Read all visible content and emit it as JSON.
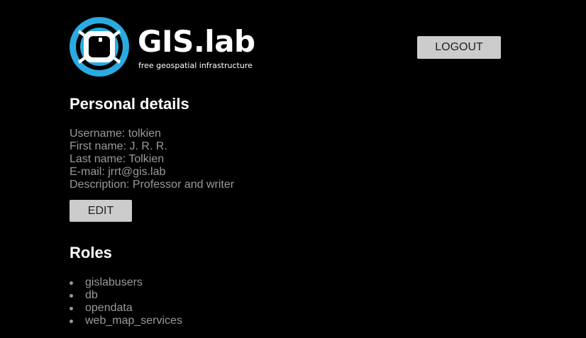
{
  "header": {
    "logo": {
      "title": "GIS.lab",
      "tagline": "free geospatial infrastructure",
      "icon": "gislab-logo-icon",
      "accent_color": "#29abe2"
    },
    "logout_label": "LOGOUT"
  },
  "personal_details": {
    "title": "Personal details",
    "rows": [
      "Username: tolkien",
      "First name: J. R. R.",
      "Last name: Tolkien",
      "E-mail: jrrt@gis.lab",
      "Description: Professor and writer"
    ],
    "edit_label": "EDIT"
  },
  "roles": {
    "title": "Roles",
    "items": [
      "gislabusers",
      "db",
      "opendata",
      "web_map_services"
    ]
  }
}
